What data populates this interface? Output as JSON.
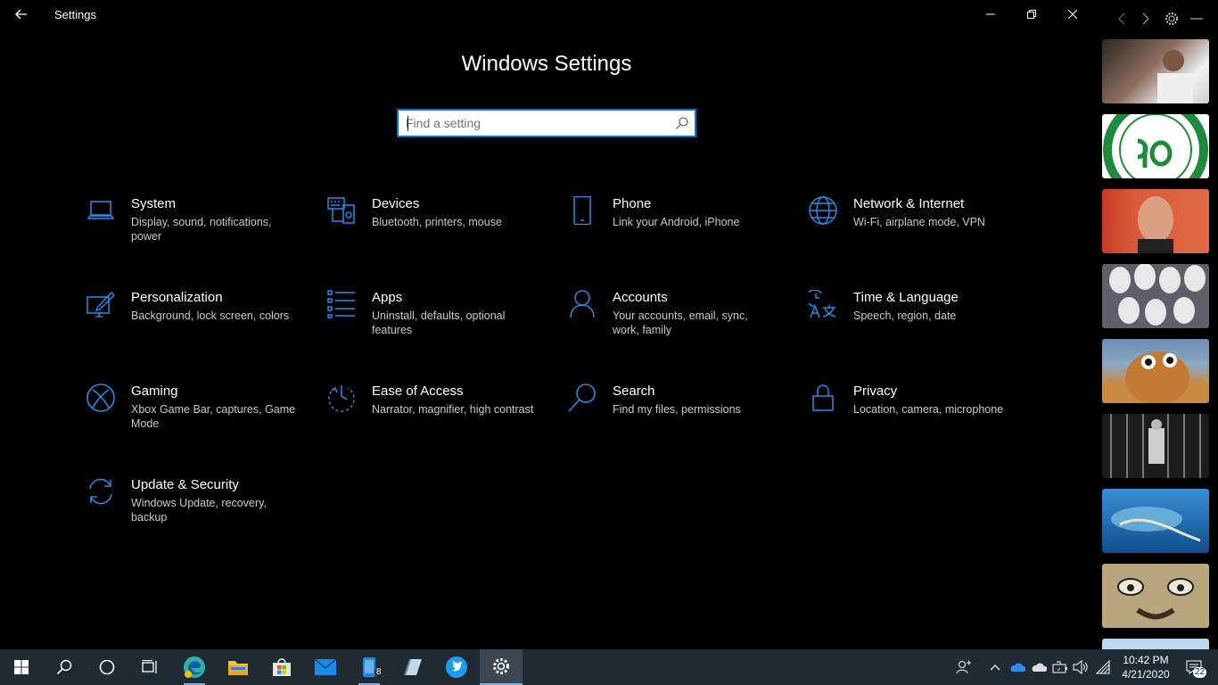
{
  "window": {
    "title": "Settings",
    "back_icon": "back-arrow-icon",
    "min_icon": "minimize-icon",
    "restore_icon": "restore-icon",
    "close_icon": "close-icon"
  },
  "page": {
    "title": "Windows Settings"
  },
  "search": {
    "placeholder": "Find a setting",
    "value": "",
    "icon": "search-icon"
  },
  "accent_color": "#0078d7",
  "categories": [
    {
      "id": "system",
      "title": "System",
      "desc": "Display, sound, notifications, power",
      "icon": "laptop-icon"
    },
    {
      "id": "devices",
      "title": "Devices",
      "desc": "Bluetooth, printers, mouse",
      "icon": "keyboard-icon"
    },
    {
      "id": "phone",
      "title": "Phone",
      "desc": "Link your Android, iPhone",
      "icon": "phone-icon"
    },
    {
      "id": "network",
      "title": "Network & Internet",
      "desc": "Wi-Fi, airplane mode, VPN",
      "icon": "globe-icon"
    },
    {
      "id": "personalization",
      "title": "Personalization",
      "desc": "Background, lock screen, colors",
      "icon": "pen-screen-icon"
    },
    {
      "id": "apps",
      "title": "Apps",
      "desc": "Uninstall, defaults, optional features",
      "icon": "apps-list-icon"
    },
    {
      "id": "accounts",
      "title": "Accounts",
      "desc": "Your accounts, email, sync, work, family",
      "icon": "person-icon"
    },
    {
      "id": "time",
      "title": "Time & Language",
      "desc": "Speech, region, date",
      "icon": "time-language-icon"
    },
    {
      "id": "gaming",
      "title": "Gaming",
      "desc": "Xbox Game Bar, captures, Game Mode",
      "icon": "xbox-icon"
    },
    {
      "id": "ease",
      "title": "Ease of Access",
      "desc": "Narrator, magnifier, high contrast",
      "icon": "ease-of-access-icon"
    },
    {
      "id": "search",
      "title": "Search",
      "desc": "Find my files, permissions",
      "icon": "magnifier-icon"
    },
    {
      "id": "privacy",
      "title": "Privacy",
      "desc": "Location, camera, microphone",
      "icon": "lock-icon"
    },
    {
      "id": "update",
      "title": "Update & Security",
      "desc": "Windows Update, recovery, backup",
      "icon": "sync-arrows-icon"
    }
  ],
  "side_panel": {
    "nav_icons": [
      "chevron-left-icon",
      "chevron-right-icon",
      "gear-icon",
      "minimize-icon"
    ],
    "thumbnails": [
      {
        "icon": "photo-man-icon",
        "color": "#5a4a44"
      },
      {
        "icon": "green-seal-logo-icon",
        "color": "#1f8a3b"
      },
      {
        "icon": "photo-actor-icon",
        "color": "#b33a2a"
      },
      {
        "icon": "photo-masks-icon",
        "color": "#6b6f78"
      },
      {
        "icon": "photo-dog-icon",
        "color": "#b0702e"
      },
      {
        "icon": "photo-figure-icon",
        "color": "#333333"
      },
      {
        "icon": "photo-island-icon",
        "color": "#1c6ab0"
      },
      {
        "icon": "photo-cartoon-icon",
        "color": "#b7a27a"
      },
      {
        "icon": "photo-partial-icon",
        "color": "#bcd8ee"
      }
    ]
  },
  "taskbar": {
    "apps": [
      {
        "name": "start",
        "icon": "windows-logo-icon"
      },
      {
        "name": "search",
        "icon": "search-icon"
      },
      {
        "name": "cortana",
        "icon": "cortana-circle-icon"
      },
      {
        "name": "task-view",
        "icon": "task-view-icon"
      },
      {
        "name": "edge",
        "icon": "edge-icon"
      },
      {
        "name": "file-explorer",
        "icon": "folder-icon"
      },
      {
        "name": "store",
        "icon": "store-bag-icon"
      },
      {
        "name": "mail",
        "icon": "mail-icon"
      },
      {
        "name": "phone-app",
        "icon": "phone-app-icon",
        "badge": "8"
      },
      {
        "name": "notes",
        "icon": "notes-icon"
      },
      {
        "name": "twitter",
        "icon": "twitter-icon"
      },
      {
        "name": "settings",
        "icon": "gear-icon"
      }
    ],
    "tray_icons": [
      "people-icon",
      "chevron-up-icon",
      "onedrive-icon",
      "cloud-icon",
      "battery-icon",
      "volume-icon",
      "wifi-icon"
    ],
    "time": "10:42 PM",
    "date": "4/21/2020",
    "notification_count": "22"
  }
}
